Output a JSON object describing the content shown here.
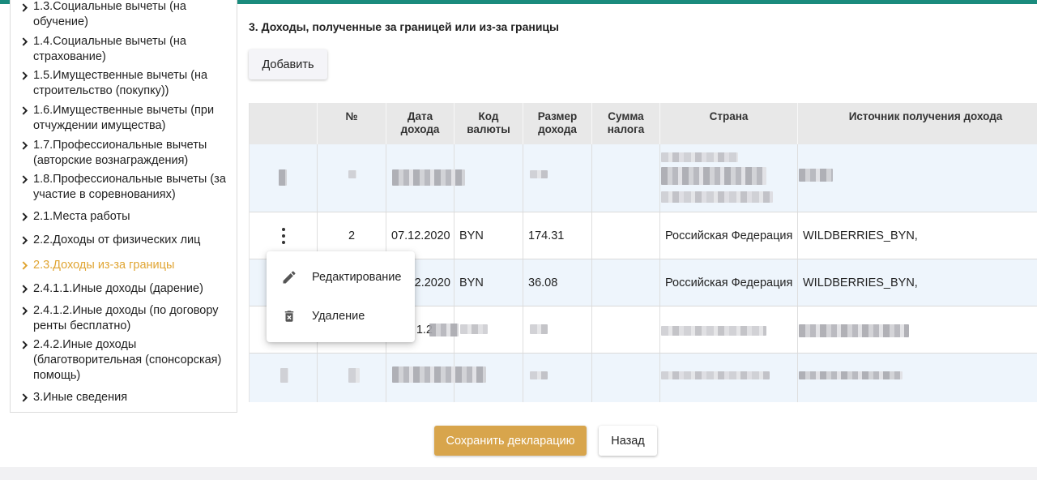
{
  "sidebar": {
    "items": [
      {
        "label": "1.3.Социальные вычеты (на обучение)"
      },
      {
        "label": "1.4.Социальные вычеты (на страхование)"
      },
      {
        "label": "1.5.Имущественные вычеты (на строительство (покупку))"
      },
      {
        "label": "1.6.Имущественные вычеты (при отчуждении имущества)"
      },
      {
        "label": "1.7.Профессиональные вычеты (авторские вознаграждения)"
      },
      {
        "label": "1.8.Профессиональные вычеты (за участие в соревнованиях)"
      },
      {
        "label": "2.1.Места работы"
      },
      {
        "label": "2.2.Доходы от физических лиц"
      },
      {
        "label": "2.3.Доходы из-за границы",
        "active": true
      },
      {
        "label": "2.4.1.1.Иные доходы (дарение)"
      },
      {
        "label": "2.4.1.2.Иные доходы (по договору ренты бесплатно)"
      },
      {
        "label": "2.4.2.Иные доходы (благотворительная (спонсорская) помощь)"
      },
      {
        "label": "3.Иные сведения"
      }
    ],
    "active_color": "#e0a533"
  },
  "main": {
    "section_title": "3. Доходы, полученные за границей или из-за границы",
    "add_button": "Добавить",
    "table": {
      "headers": {
        "num": "№",
        "date": "Дата дохода",
        "currency": "Код валюты",
        "amount": "Размер дохода",
        "tax": "Сумма налога",
        "country": "Страна",
        "source": "Источник получения дохода"
      },
      "rows": [
        {
          "num": "2",
          "date": "07.12.2020",
          "currency": "BYN",
          "amount": "174.31",
          "tax": "",
          "country": "Российская Федерация",
          "source": "WILDBERRIES_BYN,"
        },
        {
          "date_partial": "2.2020",
          "currency": "BYN",
          "amount": "36.08",
          "tax": "",
          "country": "Российская Федерация",
          "source": "WILDBERRIES_BYN,"
        },
        {
          "date_partial": "1.2"
        }
      ]
    },
    "context_menu": {
      "edit": "Редактирование",
      "delete": "Удаление"
    }
  },
  "footer": {
    "save_button": "Сохранить декларацию",
    "back_button": "Назад"
  },
  "colors": {
    "accent_top": "#1a8b7d",
    "save_button": "#d8a54c",
    "row_stripe": "#eef5fc"
  }
}
